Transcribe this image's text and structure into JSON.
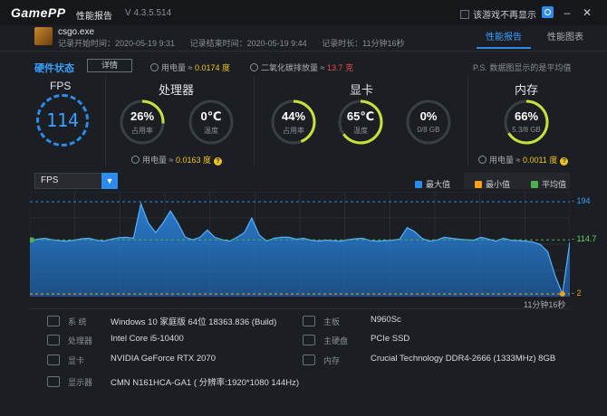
{
  "titlebar": {
    "logo": "GamePP",
    "title": "性能报告",
    "version": "V 4.3.5.514",
    "no_display": "该游戏不再显示"
  },
  "game": {
    "name": "csgo.exe",
    "record_start": "记录开始时间：2020-05-19 9:31",
    "record_end": "记录结束时间：2020-05-19 9:44",
    "record_duration": "记录时长：11分钟16秒"
  },
  "tabs": [
    {
      "label": "性能报告",
      "active": true
    },
    {
      "label": "性能图表",
      "active": false
    }
  ],
  "hardware": {
    "title": "硬件状态",
    "details_label": "详情",
    "power_label": "用电量 ≈ ",
    "power_value": "0.0174 度",
    "co2_label": "二氧化碳排放量 ≈ ",
    "co2_value": "13.7 克",
    "note": "P.S. 数据图显示的是平均值"
  },
  "fps": {
    "title": "FPS",
    "value": "114"
  },
  "cpu": {
    "title": "处理器",
    "usage": {
      "value": "26%",
      "label": "占用率",
      "pct": 0.26
    },
    "temp": {
      "value": "0℃",
      "label": "温度",
      "pct": 0
    },
    "power_label": "用电量 ≈ ",
    "power_value": "0.0163 度"
  },
  "gpu": {
    "title": "显卡",
    "usage": {
      "value": "44%",
      "label": "占用率",
      "pct": 0.44
    },
    "temp": {
      "value": "65℃",
      "label": "温度",
      "pct": 0.65
    },
    "vram": {
      "value": "0%",
      "label": "0/8 GB",
      "pct": 0
    }
  },
  "memory": {
    "title": "内存",
    "usage": {
      "value": "66%",
      "label": "5.3/8 GB",
      "pct": 0.66
    },
    "power_label": "用电量 ≈ ",
    "power_value": "0.0011 度"
  },
  "chart": {
    "selector": "FPS",
    "legend": [
      {
        "name": "最大值",
        "color": "#2d8ceb"
      },
      {
        "name": "最小值",
        "color": "#f2a11d"
      },
      {
        "name": "平均值",
        "color": "#4caf50"
      }
    ],
    "duration_label": "11分钟16秒"
  },
  "chart_data": {
    "type": "area",
    "title": "",
    "series": [
      {
        "name": "FPS",
        "values": [
          112,
          116,
          118,
          115,
          113,
          112,
          114,
          117,
          118,
          114,
          112,
          116,
          119,
          120,
          118,
          190,
          150,
          130,
          150,
          175,
          150,
          120,
          115,
          120,
          135,
          120,
          115,
          112,
          120,
          130,
          160,
          125,
          112,
          118,
          120,
          120,
          116,
          118,
          114,
          112,
          114,
          113,
          112,
          115,
          117,
          118,
          113,
          112,
          113,
          114,
          116,
          140,
          132,
          118,
          112,
          114,
          120,
          118,
          116,
          115,
          114,
          120,
          116,
          112,
          118,
          114,
          113,
          112,
          110,
          105,
          90,
          40,
          2,
          110
        ]
      }
    ],
    "max": 194,
    "min": 2,
    "avg": 114.7,
    "ylim": [
      0,
      200
    ],
    "xlabel": "",
    "ylabel": ""
  },
  "system": {
    "rows": [
      {
        "key": "系 统",
        "value": "Windows 10 家庭版 64位  18363.836 (Build)",
        "icon": "monitor-icon"
      },
      {
        "key": "处理器",
        "value": "Intel Core i5-10400",
        "icon": "cpu-icon"
      },
      {
        "key": "显卡",
        "value": "NVIDIA GeForce RTX 2070",
        "icon": "gpu-icon"
      },
      {
        "key": "显示器",
        "value": "CMN N161HCA-GA1 ( 分辨率:1920*1080 144Hz)",
        "icon": "display-icon"
      }
    ],
    "rows_right": [
      {
        "key": "主板",
        "value": "N960Sc",
        "icon": "motherboard-icon"
      },
      {
        "key": "主硬盘",
        "value": "PCIe SSD",
        "icon": "disk-icon"
      },
      {
        "key": "内存",
        "value": "Crucial Technology DDR4-2666 (1333MHz) 8GB",
        "icon": "memory-icon"
      }
    ]
  }
}
